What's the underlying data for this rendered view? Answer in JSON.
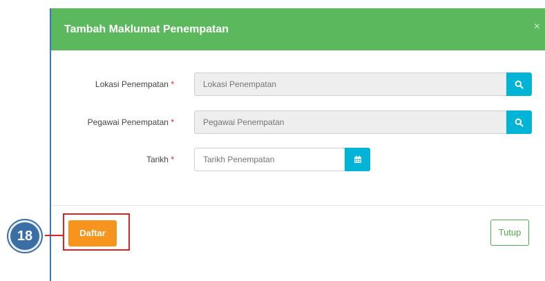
{
  "modal": {
    "title": "Tambah Maklumat Penempatan",
    "close_glyph": "×"
  },
  "form": {
    "lokasi": {
      "label": "Lokasi Penempatan",
      "required_mark": "*",
      "placeholder": "Lokasi Penempatan",
      "button_icon": "search-icon"
    },
    "pegawai": {
      "label": "Pegawai Penempatan",
      "required_mark": "*",
      "placeholder": "Pegawai Penempatan",
      "button_icon": "search-icon"
    },
    "tarikh": {
      "label": "Tarikh",
      "required_mark": "*",
      "placeholder": "Tarikh Penempatan",
      "button_icon": "calendar-icon"
    }
  },
  "footer": {
    "daftar_label": "Daftar",
    "tutup_label": "Tutup"
  },
  "annotation": {
    "step_number": "18"
  },
  "colors": {
    "header_green": "#5cb85c",
    "accent_cyan": "#00b4d8",
    "daftar_orange": "#f7941d",
    "callout_red": "#e02020",
    "step_blue": "#3a6ea5"
  }
}
